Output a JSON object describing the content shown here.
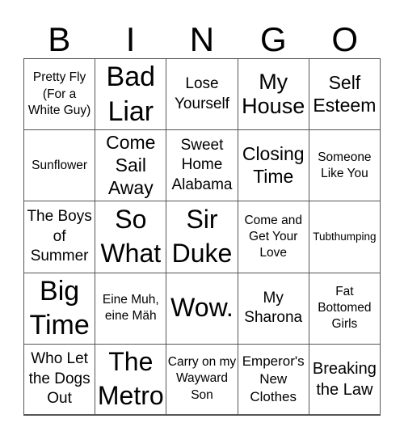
{
  "header": {
    "letters": [
      "B",
      "I",
      "N",
      "G",
      "O"
    ]
  },
  "board": {
    "rows": [
      [
        "Pretty Fly (For a White Guy)",
        "Bad Liar",
        "Lose Yourself",
        "My House",
        "Self Esteem"
      ],
      [
        "Sunflower",
        "Come Sail Away",
        "Sweet Home Alabama",
        "Closing Time",
        "Someone Like You"
      ],
      [
        "The Boys of Summer",
        "So What",
        "Sir Duke",
        "Come and Get Your Love",
        "Tubthumping"
      ],
      [
        "Big Time",
        "Eine Muh, eine Mäh",
        "Wow.",
        "My Sharona",
        "Fat Bottomed Girls"
      ],
      [
        "Who Let the Dogs Out",
        "The Metro",
        "Carry on my Wayward Son",
        "Emperor's New Clothes",
        "Breaking the Law"
      ]
    ]
  }
}
